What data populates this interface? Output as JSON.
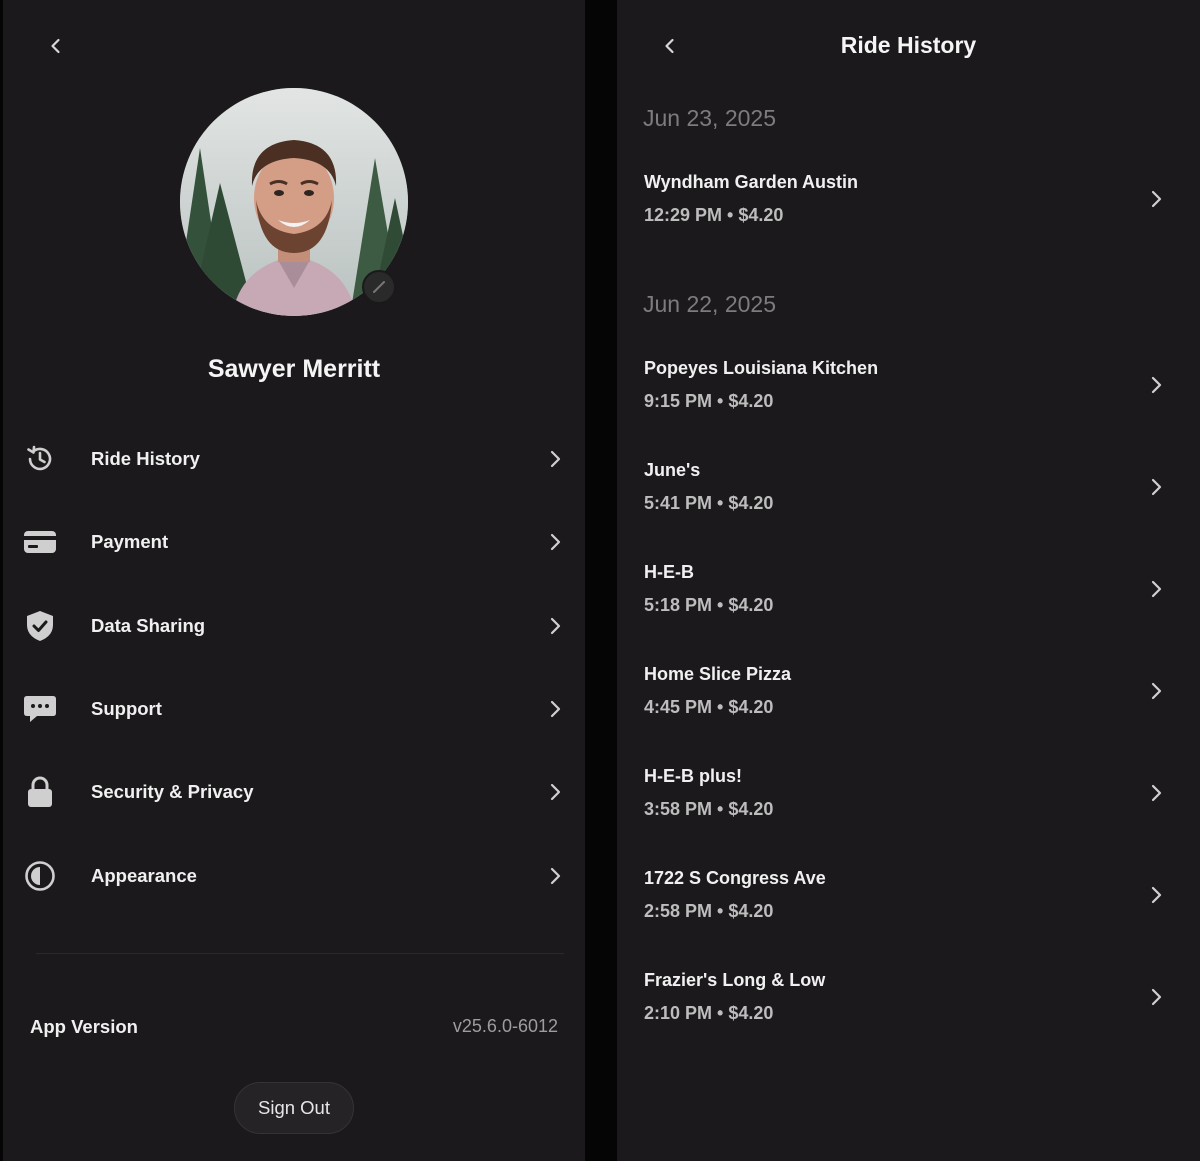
{
  "profile": {
    "name": "Sawyer Merritt",
    "menu": [
      {
        "label": "Ride History",
        "icon": "history-icon"
      },
      {
        "label": "Payment",
        "icon": "credit-card-icon"
      },
      {
        "label": "Data Sharing",
        "icon": "shield-check-icon"
      },
      {
        "label": "Support",
        "icon": "chat-bubble-icon"
      },
      {
        "label": "Security & Privacy",
        "icon": "lock-icon"
      },
      {
        "label": "Appearance",
        "icon": "contrast-icon"
      }
    ],
    "app_version_label": "App Version",
    "app_version_value": "v25.6.0-6012",
    "sign_out_label": "Sign Out"
  },
  "ride_history": {
    "title": "Ride History",
    "groups": [
      {
        "date": "Jun 23, 2025",
        "rides": [
          {
            "place": "Wyndham Garden Austin",
            "time": "12:29 PM",
            "price": "$4.20"
          }
        ]
      },
      {
        "date": "Jun 22, 2025",
        "rides": [
          {
            "place": "Popeyes Louisiana Kitchen",
            "time": "9:15 PM",
            "price": "$4.20"
          },
          {
            "place": "June's",
            "time": "5:41 PM",
            "price": "$4.20"
          },
          {
            "place": "H-E-B",
            "time": "5:18 PM",
            "price": "$4.20"
          },
          {
            "place": "Home Slice Pizza",
            "time": "4:45 PM",
            "price": "$4.20"
          },
          {
            "place": "H-E-B plus!",
            "time": "3:58 PM",
            "price": "$4.20"
          },
          {
            "place": "1722 S Congress Ave",
            "time": "2:58 PM",
            "price": "$4.20"
          },
          {
            "place": "Frazier's Long & Low",
            "time": "2:10 PM",
            "price": "$4.20"
          }
        ]
      }
    ]
  },
  "colors": {
    "background": "#1b191b",
    "separator": "#050505",
    "text_primary": "#f0f0f0",
    "text_secondary": "#bdbdbd",
    "date_header": "#7d7c7d",
    "version_text": "#9d9d9d"
  }
}
